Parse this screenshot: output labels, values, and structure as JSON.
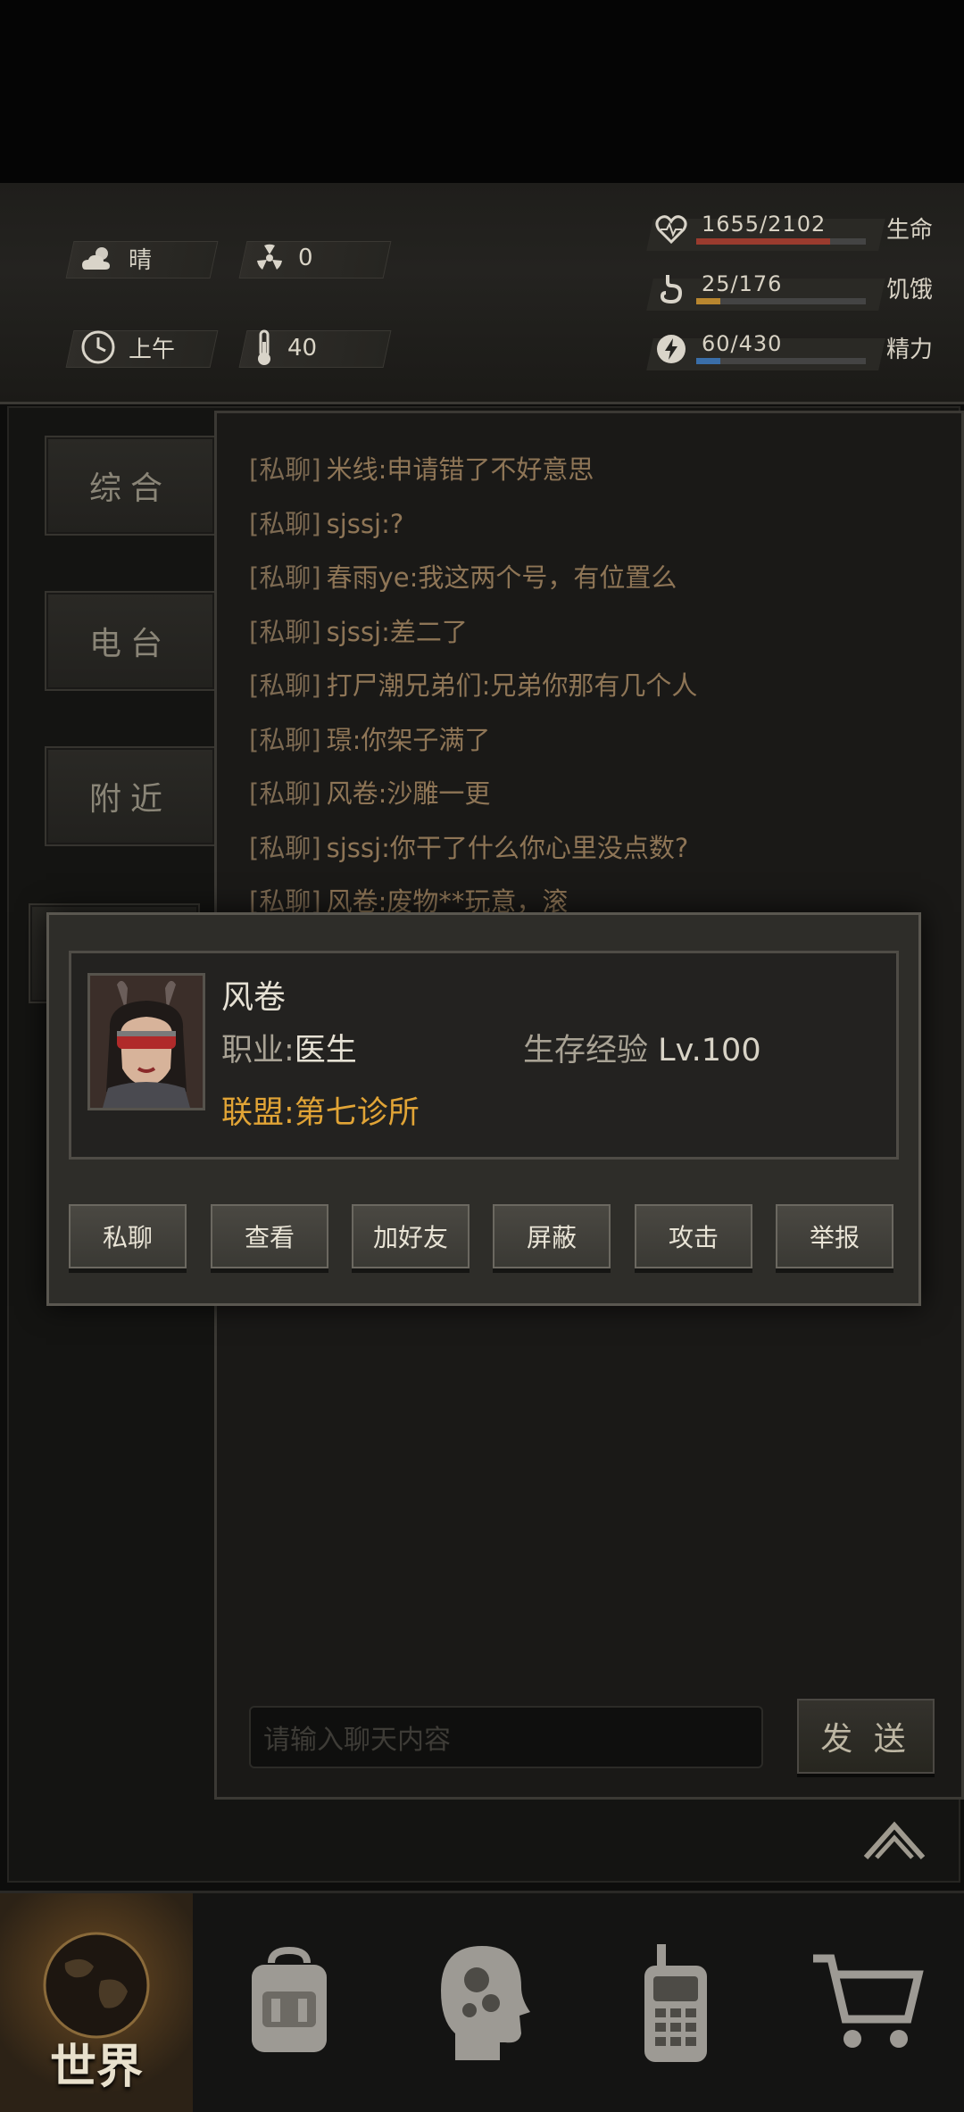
{
  "status": {
    "weather": "晴",
    "radiation": "0",
    "time_of_day": "上午",
    "temperature": "40",
    "health": {
      "text": "1655/2102",
      "label": "生命",
      "fraction": 0.787,
      "color": "#9a3b2e"
    },
    "hunger": {
      "text": "25/176",
      "label": "饥饿",
      "fraction": 0.142,
      "color": "#b8862f"
    },
    "energy": {
      "text": "60/430",
      "label": "精力",
      "fraction": 0.14,
      "color": "#3a6ea8"
    }
  },
  "side_tabs": [
    "综合",
    "电台",
    "附近"
  ],
  "chat": {
    "messages": [
      {
        "tag": "[私聊]",
        "text": "米线:申请错了不好意思"
      },
      {
        "tag": "[私聊]",
        "text": "sjssj:?"
      },
      {
        "tag": "[私聊]",
        "text": "春雨ye:我这两个号，有位置么"
      },
      {
        "tag": "[私聊]",
        "text": "sjssj:差二了"
      },
      {
        "tag": "[私聊]",
        "text": "打尸潮兄弟们:兄弟你那有几个人"
      },
      {
        "tag": "[私聊]",
        "text": "璟:你架子满了"
      },
      {
        "tag": "[私聊]",
        "text": "风卷:沙雕一更"
      },
      {
        "tag": "[私聊]",
        "text": "sjssj:你干了什么你心里没点数?"
      },
      {
        "tag": "[私聊]",
        "text": "风卷:废物**玩意，滚"
      }
    ],
    "input_placeholder": "请输入聊天内容",
    "send_label": "发 送"
  },
  "player_dialog": {
    "name": "风卷",
    "job_label": "职业:",
    "job": "医生",
    "exp_label": "生存经验",
    "exp_level": "Lv.100",
    "alliance_label": "联盟:",
    "alliance": "第七诊所",
    "buttons": [
      "私聊",
      "查看",
      "加好友",
      "屏蔽",
      "攻击",
      "举报"
    ]
  },
  "bottom_nav": {
    "active_label": "世界",
    "items": [
      "world-icon",
      "backpack-icon",
      "skills-head-icon",
      "radio-phone-icon",
      "shop-cart-icon"
    ]
  }
}
